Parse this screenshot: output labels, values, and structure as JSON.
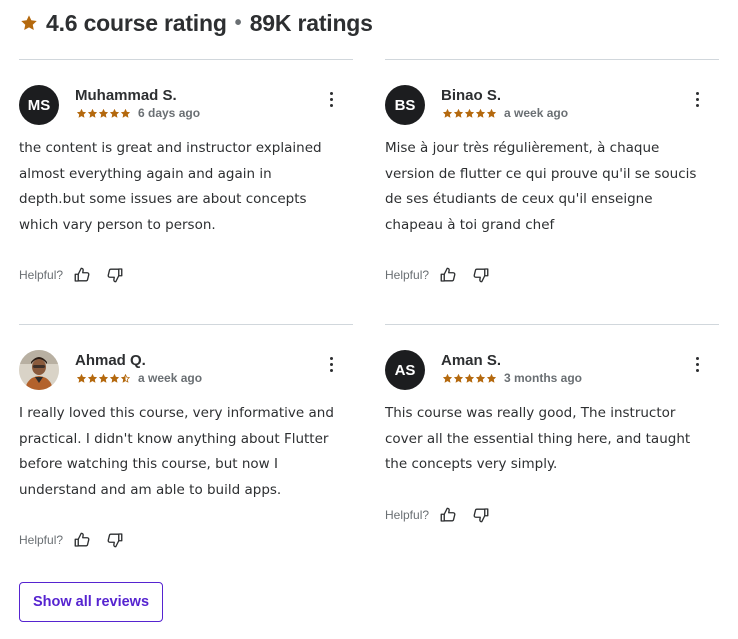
{
  "header": {
    "rating_text": "4.6 course rating",
    "separator": "•",
    "count_text": "89K ratings",
    "star_icon": "star-icon"
  },
  "colors": {
    "star": "#b4690e",
    "accent": "#5624d0",
    "text": "#2d2f31",
    "muted": "#6a6f73",
    "divider": "#d1d7dc",
    "avatar_bg": "#1c1d1f"
  },
  "reviews": [
    {
      "initials": "MS",
      "name": "Muhammad S.",
      "rating": 5,
      "time": "6 days ago",
      "text": "the content is great and instructor explained almost everything again and again in depth.but some issues are about concepts which vary person to person.",
      "helpful_label": "Helpful?"
    },
    {
      "initials": "BS",
      "name": "Binao S.",
      "rating": 5,
      "time": "a week ago",
      "text": "Mise à jour très régulièrement, à chaque version de flutter ce qui prouve qu'il se soucis de ses étudiants de ceux qu'il enseigne chapeau à toi grand chef",
      "helpful_label": "Helpful?"
    },
    {
      "initials": "",
      "avatar_type": "photo",
      "name": "Ahmad Q.",
      "rating": 4.5,
      "time": "a week ago",
      "text": "I really loved this course, very informative and practical. I didn't know anything about Flutter before watching this course, but now I understand and am able to build apps.",
      "helpful_label": "Helpful?"
    },
    {
      "initials": "AS",
      "name": "Aman S.",
      "rating": 5,
      "time": "3 months ago",
      "text": "This course was really good, The instructor cover all the essential thing here, and taught the concepts very simply.",
      "helpful_label": "Helpful?"
    }
  ],
  "show_all_label": "Show all reviews"
}
